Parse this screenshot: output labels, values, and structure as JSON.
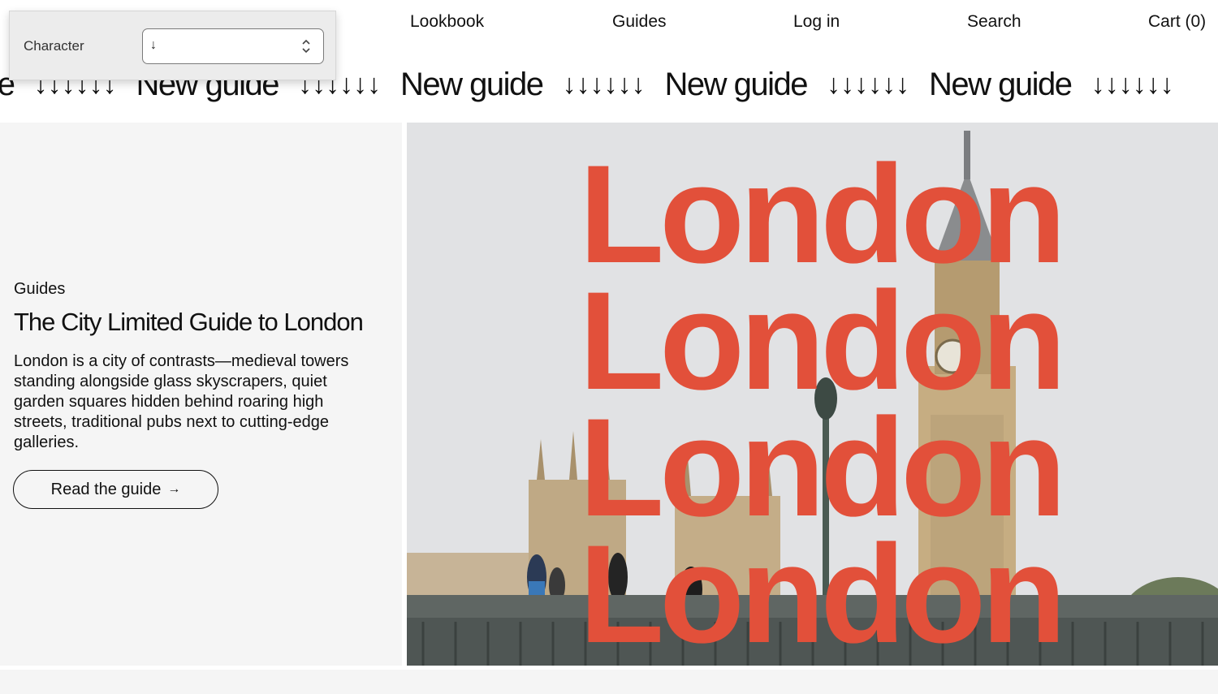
{
  "nav": {
    "items": [
      "Lookbook",
      "Guides",
      "Log in",
      "Search",
      "Cart (0)"
    ]
  },
  "picker": {
    "label": "Character",
    "value": "↓"
  },
  "ticker": {
    "partial_text": "de",
    "text": "New guide",
    "arrows": "↓↓↓↓↓↓"
  },
  "feature": {
    "eyebrow": "Guides",
    "title": "The City Limited Guide to London",
    "description": "London is a city of contrasts—medieval towers standing alongside glass skyscrapers, quiet garden squares hidden behind roaring high streets, traditional pubs next to cutting-edge galleries.",
    "cta_label": "Read the guide",
    "cta_arrow": "→"
  },
  "hero": {
    "word": "London",
    "accent_color": "#e2503a"
  }
}
